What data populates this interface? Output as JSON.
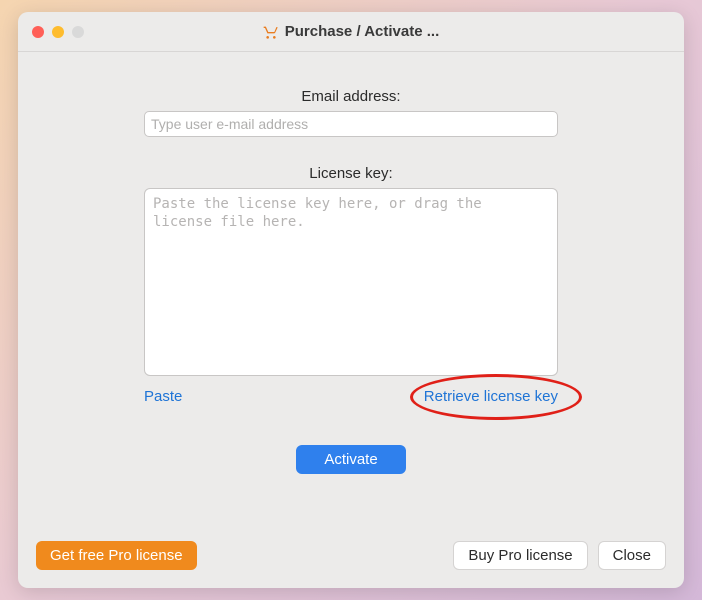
{
  "window": {
    "title": "Purchase / Activate ..."
  },
  "form": {
    "email_label": "Email address:",
    "email_placeholder": "Type user e-mail address",
    "license_label": "License key:",
    "license_placeholder": "Paste the license key here, or drag the license file here."
  },
  "links": {
    "paste": "Paste",
    "retrieve": "Retrieve license key"
  },
  "buttons": {
    "activate": "Activate",
    "get_free": "Get free Pro license",
    "buy_pro": "Buy Pro license",
    "close": "Close"
  }
}
